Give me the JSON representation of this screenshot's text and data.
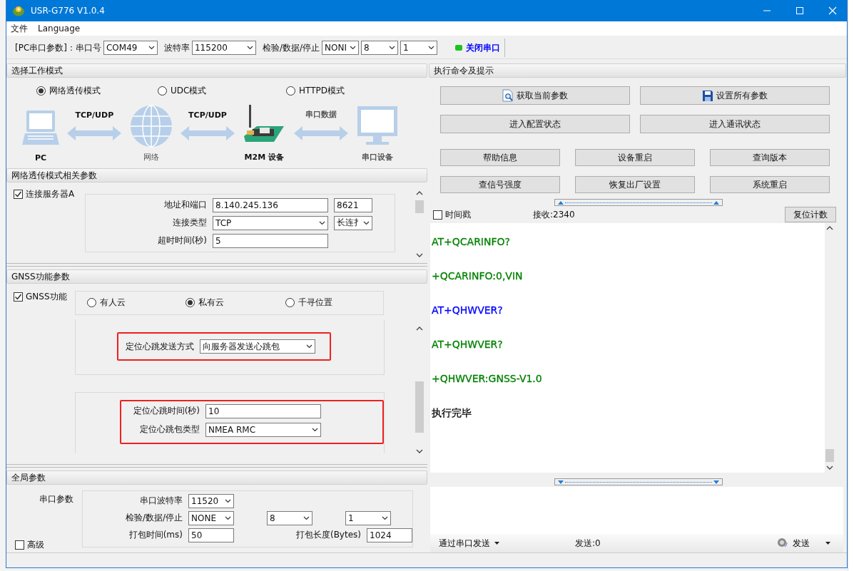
{
  "window": {
    "title": "USR-G776 V1.0.4"
  },
  "menu": [
    "文件",
    "Language"
  ],
  "serial_bar": {
    "label": "[PC串口参数]：串口号",
    "port": "COM49",
    "baud_label": "波特率",
    "baud": "115200",
    "format_label": "检验/数据/停止",
    "parity": "NONI",
    "data_bits": "8",
    "stop_bits": "1",
    "port_toggle": {
      "label": "关闭串口",
      "on": true
    }
  },
  "work_mode": {
    "title": "选择工作模式",
    "options": [
      {
        "label": "网络透传模式",
        "selected": true
      },
      {
        "label": "UDC模式",
        "selected": false
      },
      {
        "label": "HTTPD模式",
        "selected": false
      }
    ],
    "diagram": {
      "nodes": [
        "PC",
        "网络",
        "M2M 设备",
        "串口设备"
      ],
      "links": [
        "TCP/UDP",
        "TCP/UDP",
        "串口数据"
      ]
    }
  },
  "net_params": {
    "title": "网络透传模式相关参数",
    "server_a": {
      "label": "连接服务器A",
      "checked": true,
      "address_label": "地址和端口",
      "address": "8.140.245.136",
      "port": "8621",
      "type_label": "连接类型",
      "type": "TCP",
      "mode": "长连扌",
      "timeout_label": "超时时间(秒)",
      "timeout": "5"
    }
  },
  "gnss": {
    "title": "GNSS功能参数",
    "enable": {
      "label": "GNSS功能",
      "checked": true
    },
    "clouds": [
      {
        "label": "有人云",
        "selected": false
      },
      {
        "label": "私有云",
        "selected": true
      },
      {
        "label": "千寻位置",
        "selected": false
      }
    ],
    "send_mode_label": "定位心跳发送方式",
    "send_mode": "向服务器发送心跳包",
    "interval_label": "定位心跳时间(秒)",
    "interval": "10",
    "packet_type_label": "定位心跳包类型",
    "packet_type": "NMEA RMC"
  },
  "global": {
    "title": "全局参数",
    "serial_label": "串口参数",
    "baud_label": "串口波特率",
    "baud": "11520",
    "format_label": "检验/数据/停止",
    "parity": "NONE",
    "data_bits": "8",
    "stop_bits": "1",
    "pack_time_label": "打包时间(ms)",
    "pack_time": "50",
    "pack_len_label": "打包长度(Bytes)",
    "pack_len": "1024",
    "advanced": {
      "label": "高级",
      "checked": false
    }
  },
  "commands": {
    "title": "执行命令及提示",
    "main_buttons": [
      {
        "label": "获取当前参数",
        "kind": "query"
      },
      {
        "label": "设置所有参数",
        "kind": "save"
      },
      {
        "label": "进入配置状态",
        "kind": "plain"
      },
      {
        "label": "进入通讯状态",
        "kind": "plain"
      }
    ],
    "buttons": [
      "帮助信息",
      "设备重启",
      "查询版本",
      "查信号强度",
      "恢复出厂设置",
      "系统重启"
    ]
  },
  "receive": {
    "timestamp": {
      "label": "时间戳",
      "checked": false
    },
    "count": "接收:2340",
    "reset": "复位计数",
    "log": [
      {
        "text": "AT+QCARINFO?",
        "color": "#008000"
      },
      {
        "text": "+QCARINFO:0,VIN",
        "color": "#008000"
      },
      {
        "text": "AT+QHWVER?",
        "color": "#0000ff"
      },
      {
        "text": "AT+QHWVER?",
        "color": "#008000"
      },
      {
        "text": "+QHWVER:GNSS-V1.0",
        "color": "#008000"
      },
      {
        "text": "执行完毕",
        "color": "#000000"
      }
    ]
  },
  "send": {
    "via": "通过串口发送",
    "count": "发送:0",
    "button": "发送"
  }
}
